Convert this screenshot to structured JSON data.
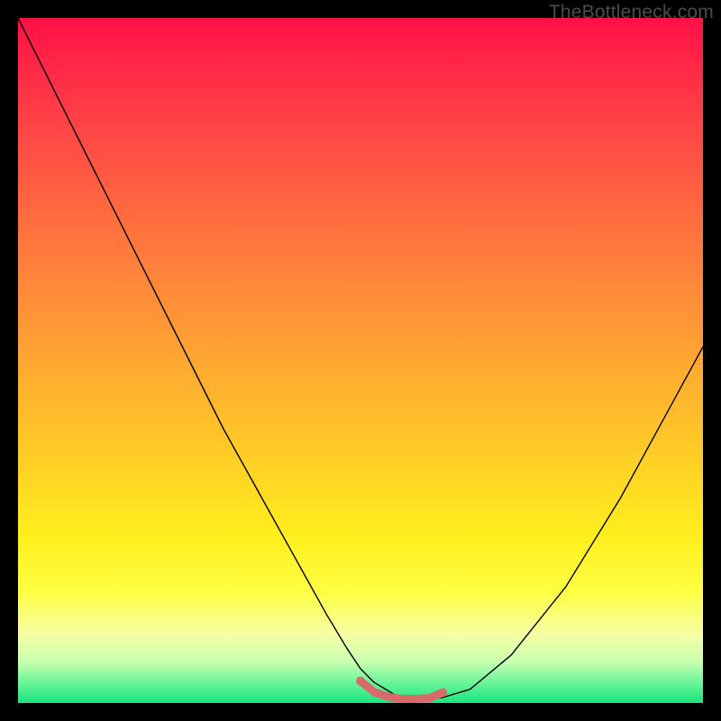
{
  "watermark": "TheBottleneck.com",
  "chart_data": {
    "type": "line",
    "title": "",
    "xlabel": "",
    "ylabel": "",
    "xlim": [
      0,
      100
    ],
    "ylim": [
      0,
      100
    ],
    "grid": false,
    "legend": false,
    "series": [
      {
        "name": "main-curve",
        "color": "#000000",
        "stroke_width": 1.2,
        "x": [
          0,
          5,
          10,
          15,
          20,
          25,
          30,
          35,
          40,
          45,
          48,
          50,
          52,
          55,
          58,
          60,
          62,
          66,
          72,
          80,
          88,
          94,
          100
        ],
        "y": [
          100,
          90,
          80,
          70,
          60,
          50,
          40,
          31,
          22,
          13,
          8,
          5,
          3,
          1.2,
          0.6,
          0.6,
          0.8,
          2,
          7,
          17,
          30,
          41,
          52
        ]
      },
      {
        "name": "bottom-marker",
        "color": "#d96a6a",
        "stroke_width": 6,
        "x": [
          50,
          52,
          54,
          56,
          58,
          60,
          62
        ],
        "y": [
          3.2,
          1.6,
          0.9,
          0.6,
          0.6,
          0.7,
          1.5
        ]
      }
    ],
    "background_gradient": {
      "direction": "vertical",
      "stops": [
        {
          "pos": 0.0,
          "color": "#ff1045"
        },
        {
          "pos": 0.3,
          "color": "#ff6f3e"
        },
        {
          "pos": 0.66,
          "color": "#ffd324"
        },
        {
          "pos": 0.9,
          "color": "#f6ffa5"
        },
        {
          "pos": 1.0,
          "color": "#18e57f"
        }
      ]
    }
  }
}
